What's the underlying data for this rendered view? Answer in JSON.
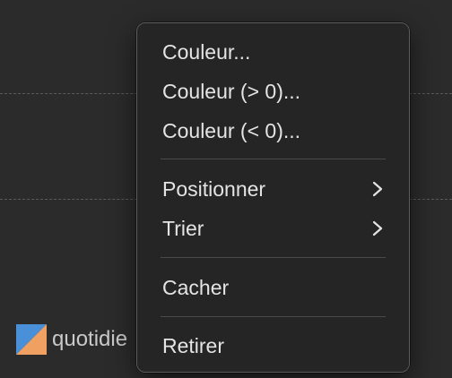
{
  "background": {
    "legend": {
      "label": "quotidie",
      "swatch_colors": [
        "#4a90d9",
        "#f0a060"
      ]
    }
  },
  "context_menu": {
    "items": [
      {
        "label": "Couleur...",
        "submenu": false
      },
      {
        "label": "Couleur (> 0)...",
        "submenu": false
      },
      {
        "label": "Couleur (< 0)...",
        "submenu": false
      },
      {
        "label": "Positionner",
        "submenu": true
      },
      {
        "label": "Trier",
        "submenu": true
      },
      {
        "label": "Cacher",
        "submenu": false
      },
      {
        "label": "Retirer",
        "submenu": false
      }
    ]
  },
  "colors": {
    "canvas_background": "#2b2b2b",
    "menu_background": "#252525",
    "menu_text": "#e4e4e4",
    "separator": "#4a4a4a"
  }
}
